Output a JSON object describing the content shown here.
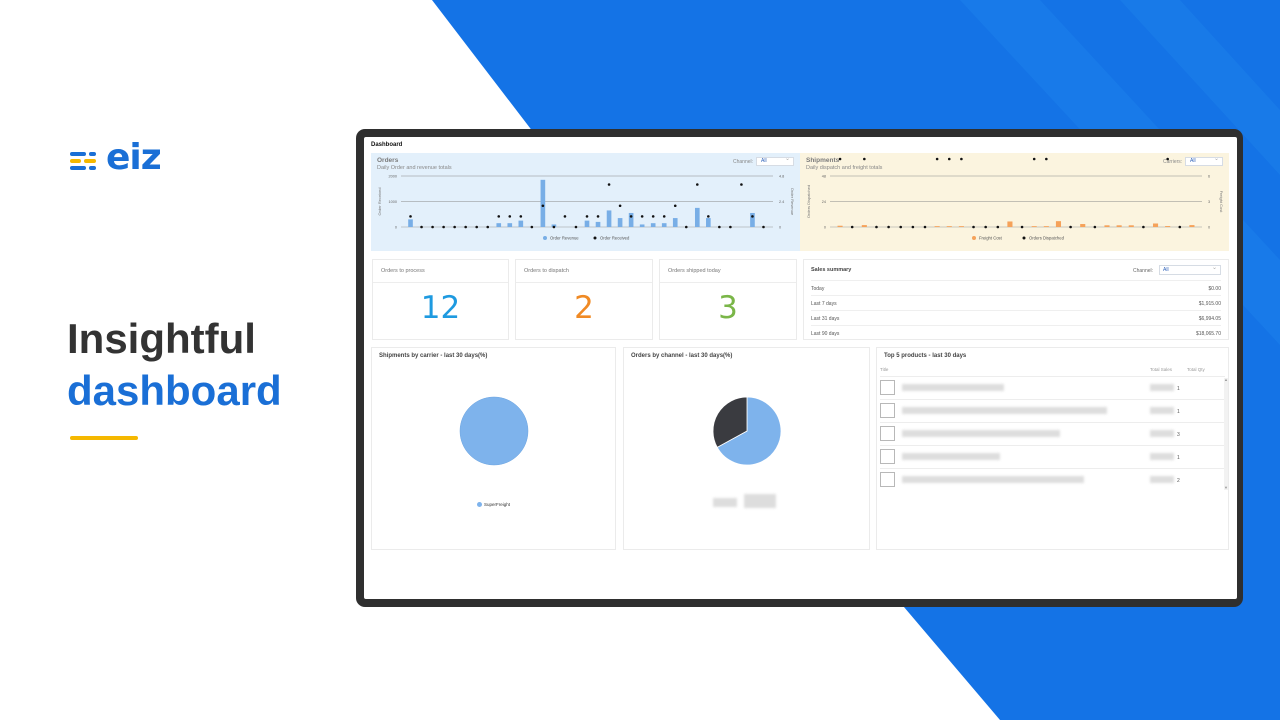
{
  "brand": {
    "name": "eiz",
    "blue": "#1a6fd6",
    "yellow": "#f5b800"
  },
  "headline": {
    "line1": "Insightful",
    "line2": "dashboard"
  },
  "dashboard": {
    "title": "Dashboard",
    "orders": {
      "title": "Orders",
      "subtitle": "Daily Order and revenue totals",
      "filter_label": "Channel:",
      "filter_value": "All",
      "y_left_label": "Order Received",
      "y_right_label": "Order Revenue",
      "y_left_ticks": [
        "2000",
        "1000",
        "0"
      ],
      "y_right_ticks": [
        "4.8",
        "2.4",
        "0"
      ],
      "legend": [
        "Order Revenue",
        "Order Received"
      ]
    },
    "shipments": {
      "title": "Shipments",
      "subtitle": "Daily dispatch and freight totals",
      "filter_label": "Carriers:",
      "filter_value": "All",
      "y_left_label": "Orders Dispatched",
      "y_right_label": "Freight Cost",
      "y_left_ticks": [
        "48",
        "24",
        "0"
      ],
      "y_right_ticks": [
        "6",
        "3",
        "0"
      ],
      "legend": [
        "Freight Cost",
        "Orders Dispatched"
      ]
    },
    "cards": [
      {
        "label": "Orders to process",
        "value": "12",
        "color": "#1e9ae0"
      },
      {
        "label": "Orders to dispatch",
        "value": "2",
        "color": "#f08a24"
      },
      {
        "label": "Orders shipped today",
        "value": "3",
        "color": "#7ab648"
      }
    ],
    "sales_summary": {
      "title": "Sales summary",
      "channel_label": "Channel:",
      "channel_value": "All",
      "rows": [
        {
          "label": "Today",
          "value": "$0.00"
        },
        {
          "label": "Last 7 days",
          "value": "$1,915.00"
        },
        {
          "label": "Last 31 days",
          "value": "$6,994.05"
        },
        {
          "label": "Last 90 days",
          "value": "$18,065.70"
        }
      ]
    },
    "shipments_by_carrier": {
      "title": "Shipments by carrier - last 30 days(%)",
      "legend": "SuperFreight"
    },
    "orders_by_channel": {
      "title": "Orders by channel - last 30 days(%)"
    },
    "top_products": {
      "title": "Top 5 products - last 30 days",
      "columns": [
        "Title",
        "Total Sales",
        "Total Qty"
      ],
      "rows": [
        {
          "qty": "1"
        },
        {
          "qty": "1"
        },
        {
          "qty": "3"
        },
        {
          "qty": "1"
        },
        {
          "qty": "2"
        }
      ]
    }
  },
  "chart_data": [
    {
      "type": "bar",
      "title": "Orders",
      "ylim": [
        0,
        2000
      ],
      "y2lim": [
        0,
        4.8
      ],
      "series": [
        {
          "name": "Order Revenue",
          "values": [
            300,
            0,
            0,
            0,
            0,
            0,
            0,
            0,
            150,
            150,
            250,
            0,
            1850,
            100,
            0,
            0,
            250,
            200,
            650,
            350,
            550,
            100,
            150,
            150,
            350,
            0,
            750,
            350,
            0,
            0,
            0,
            550,
            0
          ]
        },
        {
          "name": "Order Received",
          "values": [
            1.0,
            0,
            0,
            0,
            0,
            0,
            0,
            0,
            1.0,
            1.0,
            1.0,
            0,
            2.0,
            0,
            1.0,
            0,
            1.0,
            1.0,
            4.0,
            2.0,
            1.0,
            1.0,
            1.0,
            1.0,
            2.0,
            0,
            4.0,
            1.0,
            0,
            0,
            4.0,
            1.0,
            0
          ]
        }
      ]
    },
    {
      "type": "bar",
      "title": "Shipments",
      "ylim": [
        0,
        48
      ],
      "y2lim": [
        0,
        6
      ],
      "series": [
        {
          "name": "Freight Cost",
          "values": [
            1.2,
            0,
            1.8,
            0,
            0,
            0,
            0,
            0,
            0.8,
            0.8,
            0.8,
            0,
            0,
            0,
            5.2,
            0,
            0.8,
            0.8,
            5.5,
            0,
            2.8,
            0,
            1.6,
            1.6,
            1.6,
            0,
            3.3,
            0.9,
            0,
            1.8
          ]
        },
        {
          "name": "Orders Dispatched",
          "values": [
            8,
            0,
            8,
            0,
            0,
            0,
            0,
            0,
            8,
            8,
            8,
            0,
            0,
            0,
            24,
            0,
            8,
            8,
            40,
            0,
            24,
            0,
            16,
            16,
            16,
            0,
            32,
            8,
            0,
            16
          ]
        }
      ]
    },
    {
      "type": "pie",
      "title": "Shipments by carrier - last 30 days(%)",
      "categories": [
        "SuperFreight"
      ],
      "values": [
        100
      ]
    },
    {
      "type": "pie",
      "title": "Orders by channel - last 30 days(%)",
      "values": [
        67,
        33
      ]
    }
  ]
}
